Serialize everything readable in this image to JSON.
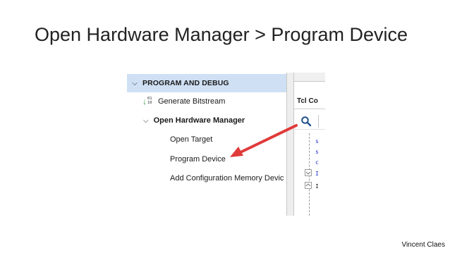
{
  "slide": {
    "title": "Open Hardware Manager > Program Device",
    "author": "Vincent Claes"
  },
  "navigator": {
    "section_header": "PROGRAM AND DEBUG",
    "items": [
      {
        "label": "Generate Bitstream",
        "icon": "generate-bitstream-icon",
        "icon_digits": [
          "01",
          "10"
        ]
      },
      {
        "label": "Open Hardware Manager",
        "expanded": true
      },
      {
        "label": "Open Target"
      },
      {
        "label": "Program Device"
      },
      {
        "label": "Add Configuration Memory Devic"
      }
    ]
  },
  "console": {
    "tab_label": "Tcl Co",
    "search_icon": "search-icon",
    "lines": [
      {
        "text": "s",
        "color": "#1f2fcf"
      },
      {
        "text": "s",
        "color": "#1f2fcf"
      },
      {
        "text": "c",
        "color": "#1f2fcf"
      },
      {
        "text": "I",
        "color": "#1f2fcf"
      },
      {
        "text": "I",
        "color": "#222222"
      }
    ]
  },
  "annotation": {
    "arrow_color": "#e03a3a"
  }
}
